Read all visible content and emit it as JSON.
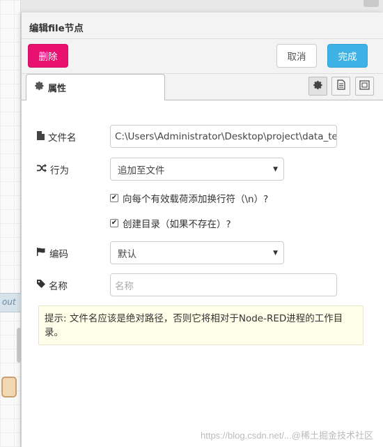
{
  "canvas": {
    "wire_label": "out"
  },
  "tray": {
    "title": "编辑file节点",
    "buttons": {
      "delete": "删除",
      "cancel": "取消",
      "done": "完成"
    },
    "tab": {
      "label": "属性",
      "icon": "gear-icon"
    },
    "tab_icons": [
      "gear-icon",
      "document-icon",
      "frame-icon"
    ]
  },
  "form": {
    "filename": {
      "label": "文件名",
      "icon": "file-icon",
      "value": "C:\\Users\\Administrator\\Desktop\\project\\data_test\\te"
    },
    "action": {
      "label": "行为",
      "icon": "shuffle-icon",
      "value": "追加至文件"
    },
    "append_newline": {
      "label": "向每个有效载荷添加换行符（\\n）?",
      "checked": true
    },
    "create_dir": {
      "label": "创建目录（如果不存在）?",
      "checked": true
    },
    "encoding": {
      "label": "编码",
      "icon": "flag-icon",
      "value": "默认"
    },
    "name": {
      "label": "名称",
      "icon": "tag-icon",
      "placeholder": "名称"
    },
    "tip": "提示: 文件名应该是绝对路径，否则它将相对于Node-RED进程的工作目录。"
  },
  "watermark": "https://blog.csdn.net/...@稀土掘金技术社区"
}
